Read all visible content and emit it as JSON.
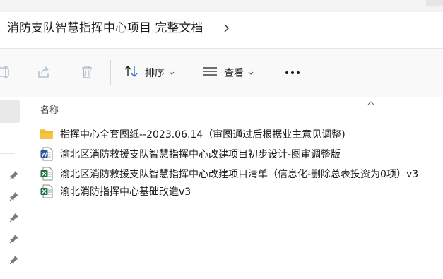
{
  "address": {
    "breadcrumb": "消防支队智慧指挥中心项目 完整文档",
    "chevron_icon": "chevron-right-icon"
  },
  "toolbar": {
    "sort_label": "排序",
    "view_label": "查看",
    "icons": [
      "rename-icon",
      "share-icon",
      "delete-icon",
      "sort-icon",
      "view-icon",
      "more-icon"
    ]
  },
  "columns": {
    "name_header": "名称"
  },
  "files": [
    {
      "name": "指挥中心全套图纸--2023.06.14（审图通过后根据业主意见调整)",
      "icon": "folder-icon"
    },
    {
      "name": "渝北区消防救援支队智慧指挥中心改建项目初步设计-图审调整版",
      "icon": "word-doc-icon"
    },
    {
      "name": "渝北区消防救援支队智慧指挥中心改建项目清单（信息化-删除总表投资为0项）v3",
      "icon": "excel-icon"
    },
    {
      "name": "渝北消防指挥中心基础改造v3",
      "icon": "excel-icon"
    }
  ],
  "nav": {
    "pins": [
      "pin-icon",
      "pin-icon",
      "pin-icon",
      "pin-icon",
      "pin-icon"
    ]
  },
  "colors": {
    "folder": "#F4C542",
    "word": "#2B579A",
    "excel": "#1E7145",
    "toolbar_bg": "#F9F9F9",
    "selection": "#E9E9E9"
  }
}
